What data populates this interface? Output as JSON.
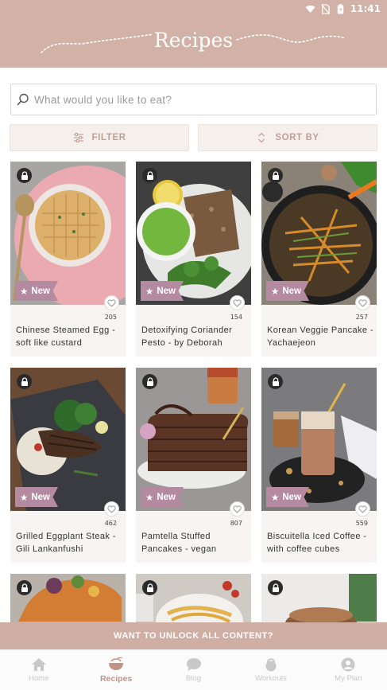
{
  "status_bar": {
    "time": "11:41"
  },
  "header": {
    "title": "Recipes"
  },
  "search": {
    "placeholder": "What would you like to eat?"
  },
  "controls": {
    "filter_label": "FILTER",
    "sort_label": "SORT BY"
  },
  "recipes": [
    {
      "name": "Chinese Steamed Egg - soft like custard",
      "likes": "205",
      "badge": "New",
      "locked": true
    },
    {
      "name": "Detoxifying Coriander Pesto - by Deborah",
      "likes": "154",
      "badge": "New",
      "locked": true
    },
    {
      "name": "Korean Veggie Pancake - Yachaejeon",
      "likes": "257",
      "badge": "New",
      "locked": true
    },
    {
      "name": "Grilled Eggplant Steak - Gili Lankanfushi",
      "likes": "462",
      "badge": "New",
      "locked": true
    },
    {
      "name": "Pamtella Stuffed Pancakes - vegan",
      "likes": "807",
      "badge": "New",
      "locked": true
    },
    {
      "name": "Biscuitella Iced Coffee - with coffee cubes",
      "likes": "559",
      "badge": "New",
      "locked": true
    }
  ],
  "unlock_banner": "WANT TO UNLOCK ALL CONTENT?",
  "bottom_nav": [
    {
      "label": "Home",
      "icon": "home-icon",
      "active": false
    },
    {
      "label": "Recipes",
      "icon": "bowl-icon",
      "active": true
    },
    {
      "label": "Blog",
      "icon": "chat-icon",
      "active": false
    },
    {
      "label": "Workouts",
      "icon": "kettlebell-icon",
      "active": false
    },
    {
      "label": "My Plan",
      "icon": "person-icon",
      "active": false
    }
  ],
  "colors": {
    "header_bg": "#d2b1a6",
    "badge": "#b48aa1",
    "active_nav": "#c29486"
  }
}
